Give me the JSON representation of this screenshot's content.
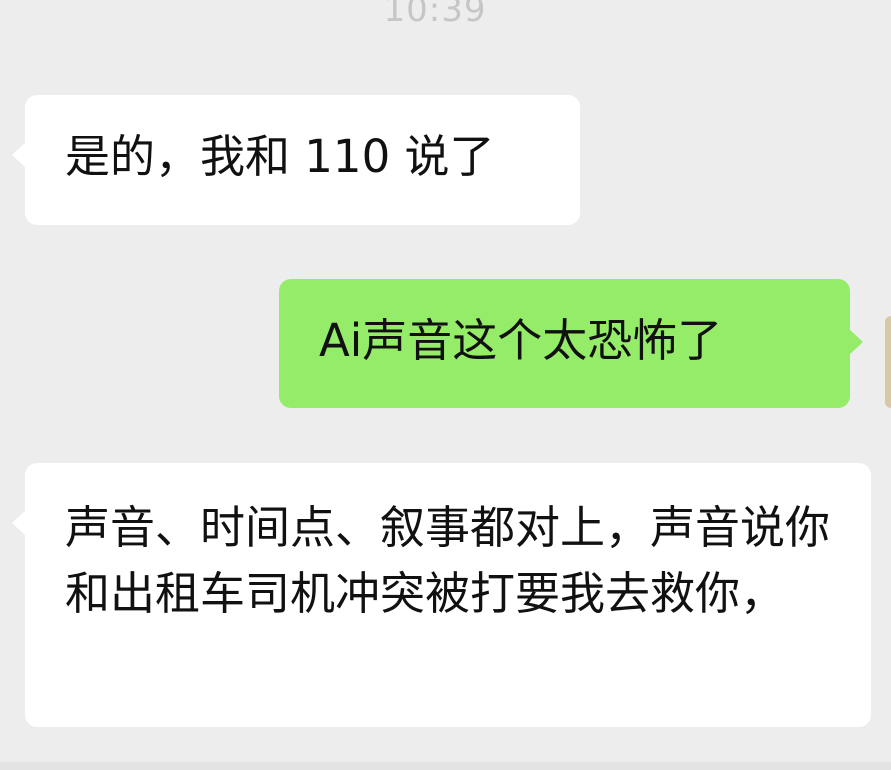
{
  "chat": {
    "timestamp": "10:39",
    "messages": [
      {
        "sender": "other",
        "text": "是的，我和 110 说了"
      },
      {
        "sender": "me",
        "text": "Ai声音这个太恐怖了"
      },
      {
        "sender": "other",
        "text": "声音、时间点、叙事都对上，声音说你和出租车司机冲突被打要我去救你，"
      }
    ]
  },
  "colors": {
    "background": "#ededed",
    "received_bubble": "#ffffff",
    "sent_bubble": "#95ec69",
    "timestamp": "#c6c6c6"
  }
}
